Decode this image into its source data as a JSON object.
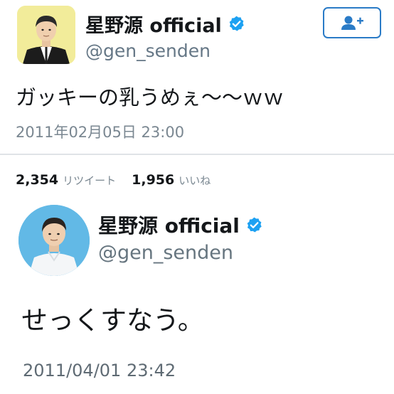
{
  "tweet1": {
    "display_name": "星野源 official",
    "handle": "@gen_senden",
    "text": "ガッキーの乳うめぇ〜〜ｗｗ",
    "timestamp": "2011年02月05日 23:00",
    "retweet_count": "2,354",
    "retweet_label": "リツイート",
    "like_count": "1,956",
    "like_label": "いいね"
  },
  "tweet2": {
    "display_name": "星野源 official",
    "handle": "@gen_senden",
    "text": "せっくすなう。",
    "timestamp": "2011/04/01 23:42"
  },
  "colors": {
    "verified_blue": "#1da1f2",
    "follow_button_border": "#2a7bc7",
    "avatar1_bg": "#f2ec9a",
    "avatar2_bg": "#62b9e6",
    "secondary_text": "#657786"
  },
  "icons": {
    "verified": "verified-badge-icon",
    "follow": "add-user-icon"
  }
}
